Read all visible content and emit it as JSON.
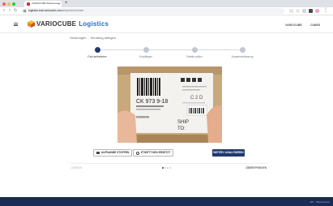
{
  "browser": {
    "tab_title": "VARIOCUBE Webservices",
    "tab_close": "×",
    "new_tab": "+",
    "url_host": "logistics.test.variocube.com",
    "url_path": "/shipments/create"
  },
  "header": {
    "brand": "VARIOCUBE",
    "app": "Logistics",
    "links": [
      "VARIOCUBE",
      "CUBES"
    ]
  },
  "breadcrumb": {
    "root": "Sendungen",
    "separator": "/",
    "current": "Sendung anlegen"
  },
  "steps": [
    {
      "label": "Foto aufnehmen",
      "active": true
    },
    {
      "label": "Empfänger",
      "active": false
    },
    {
      "label": "Details prüfen",
      "active": false
    },
    {
      "label": "Zusammenfassung",
      "active": false
    }
  ],
  "label_text": {
    "number": "CK 973 9-18",
    "shipping_top": "SHIP",
    "shipping_bottom": "TO:",
    "sticker_small": "SHIPPING"
  },
  "buttons": {
    "stop": "AUFNAHME STOPPEN",
    "retake": "ETIKETT NEU ERSETZT",
    "next": "WEITER / ANALYSIEREN"
  },
  "footer": {
    "left": "ZURÜCK",
    "right": "ÜBERSPRINGEN",
    "version": "API · Webservices"
  },
  "colors": {
    "primary": "#1e3a6e",
    "accent": "#2b6cc4",
    "footer": "#1a2c52"
  }
}
